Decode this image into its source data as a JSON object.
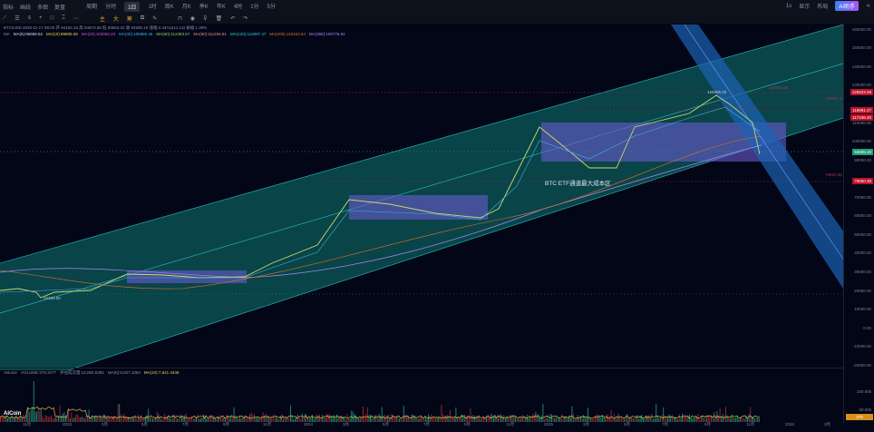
{
  "toolbar": {
    "left": [
      "指标",
      "画线",
      "多图",
      "复盘"
    ],
    "periods": [
      "周期",
      "分时",
      "1日",
      "1时",
      "周K",
      "月K",
      "季K",
      "年K",
      "4时",
      "1分",
      "5分"
    ],
    "active_period": "1日",
    "tools2": [
      "主",
      "大",
      "筹"
    ],
    "right": [
      "1s",
      "显示",
      "设置"
    ],
    "badge": "AI助手",
    "layout": "布局"
  },
  "info": {
    "symbol_line": "BTC/USD  2025-11-17 08:00  开 94182.33  高 94973.58  低 93663.32  收 94595.10  涨幅 0.44%(411.13)  振幅 1.39%",
    "ma_label": "MA",
    "ma": [
      {
        "t": "MA(5):95689.52",
        "c": "#d8dce6"
      },
      {
        "t": "MA(10):99805.08",
        "c": "#f2d14a"
      },
      {
        "t": "MA(20):103050.23",
        "c": "#e04fc8"
      },
      {
        "t": "MA(30):105885.46",
        "c": "#3fb5e8"
      },
      {
        "t": "MA(60):112383.67",
        "c": "#8fd35a"
      },
      {
        "t": "MA(90):111206.81",
        "c": "#f08a8a"
      },
      {
        "t": "MA(120):112697.47",
        "c": "#2fd0d0"
      },
      {
        "t": "MA(200):110463.84",
        "c": "#e07028"
      },
      {
        "t": "MA(365):100776.94",
        "c": "#a98af0"
      }
    ]
  },
  "yaxis": [
    "160000.00",
    "150000.00",
    "140000.00",
    "130000.00",
    "110000.00",
    "100000.00",
    "90000.00",
    "70000.00",
    "60000.00",
    "50000.00",
    "40000.00",
    "30000.00",
    "20000.00",
    "10000.00",
    "0.00",
    "-10000.00",
    "-20000.00"
  ],
  "yvals": [
    160000,
    150000,
    140000,
    130000,
    110000,
    100000,
    90000,
    70000,
    60000,
    50000,
    40000,
    30000,
    20000,
    10000,
    0,
    -10000,
    -20000
  ],
  "price_labels": [
    {
      "t": "126523.49",
      "v": 126523,
      "c": "#c0102a"
    },
    {
      "t": "116991.47",
      "v": 116991,
      "c": "#c0102a"
    },
    {
      "t": "117246.40",
      "v": 112800,
      "c": "#c0102a"
    },
    {
      "t": "94585.10",
      "v": 94585,
      "c": "#1f9e78"
    },
    {
      "t": "78650.38",
      "v": 78650,
      "c": "#c0102a"
    }
  ],
  "chart_marks": {
    "high_label": "126296.20",
    "low_label": "15480.00",
    "line_label_a": "116991.47",
    "line_label_b": "78650.38",
    "line_label_c": "126523.49"
  },
  "annotation": "BTC ETF通道最大成本区",
  "volume": {
    "title": "Volume",
    "vol": "VOLUME:379.3277",
    "avg": "评估成交量:12,082.5381",
    "ma5": "MA(5):9,027.1084",
    "ma10": "MA(10):7,541.4446",
    "axis": [
      "100.00k",
      "50.00k"
    ],
    "current": "379"
  },
  "xaxis": [
    [
      "11月",
      30
    ],
    [
      "2023",
      74
    ],
    [
      "3月",
      117
    ],
    [
      "5月",
      161
    ],
    [
      "7月",
      206
    ],
    [
      "9月",
      251
    ],
    [
      "11月",
      295
    ],
    [
      "2024",
      340
    ],
    [
      "3月",
      383
    ],
    [
      "5月",
      427
    ],
    [
      "7月",
      472
    ],
    [
      "9月",
      517
    ],
    [
      "11月",
      563
    ],
    [
      "2025",
      605
    ],
    [
      "3月",
      648
    ],
    [
      "5月",
      693
    ],
    [
      "7月",
      735
    ],
    [
      "9月",
      782
    ],
    [
      "11月",
      828
    ],
    [
      "2026",
      871
    ],
    [
      "3月",
      914
    ]
  ],
  "logo": "AiCoin",
  "colors": {
    "channel": "#0a4b4f",
    "down_channel": "#1d63b5",
    "box": "#6a5acd",
    "up": "#1fae8a",
    "down": "#c0303a"
  }
}
